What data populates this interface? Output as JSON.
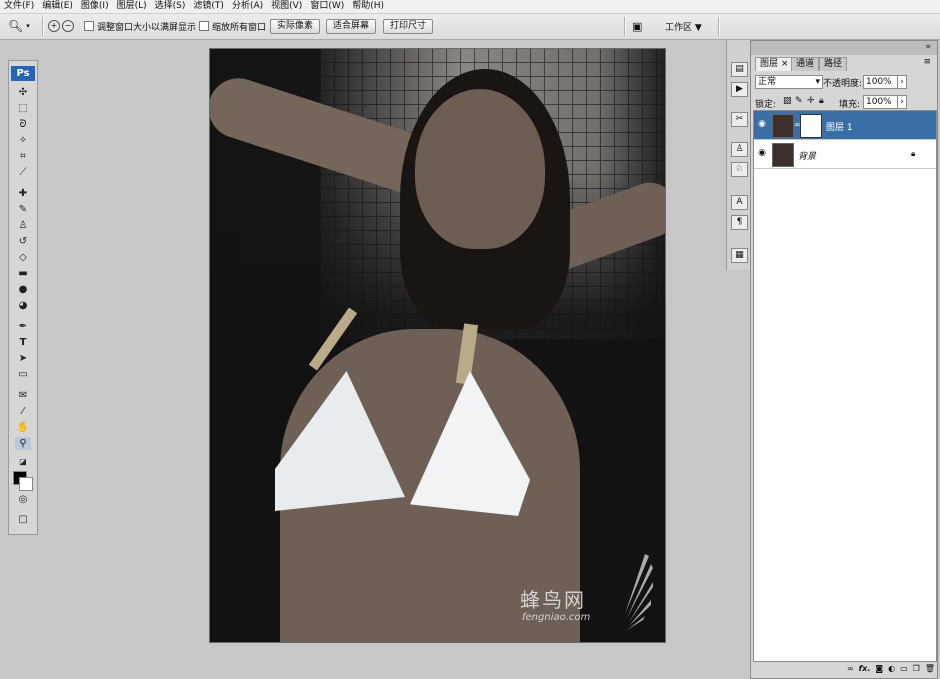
{
  "menu": [
    "文件(F)",
    "编辑(E)",
    "图像(I)",
    "图层(L)",
    "选择(S)",
    "滤镜(T)",
    "分析(A)",
    "视图(V)",
    "窗口(W)",
    "帮助(H)"
  ],
  "options": {
    "resize_windows_label": "调整窗口大小以满屏显示",
    "zoom_all_label": "缩放所有窗口",
    "actual_pixels": "实际像素",
    "fit_screen": "适合屏幕",
    "print_size": "打印尺寸",
    "workspace": "工作区 ▼"
  },
  "toolbox": {
    "logo": "Ps"
  },
  "canvas": {
    "watermark_cn": "蜂鸟网",
    "watermark_en": "fengniao.com"
  },
  "panel": {
    "tabs": [
      "图层",
      "通道",
      "路径"
    ],
    "tab_close": "×",
    "blend_mode": "正常",
    "opacity_label": "不透明度:",
    "opacity_value": "100%",
    "lock_label": "锁定:",
    "fill_label": "填充:",
    "fill_value": "100%",
    "layers": [
      {
        "name": "图层 1",
        "selected": true
      },
      {
        "name": "背景",
        "selected": false
      }
    ],
    "bottom_icons": [
      "link-icon",
      "fx-icon",
      "mask-icon",
      "adjustment-icon",
      "group-icon",
      "new-layer-icon",
      "trash-icon"
    ]
  },
  "colors": {
    "accent": "#3a6ea5",
    "ps_logo": "#2864b6"
  }
}
